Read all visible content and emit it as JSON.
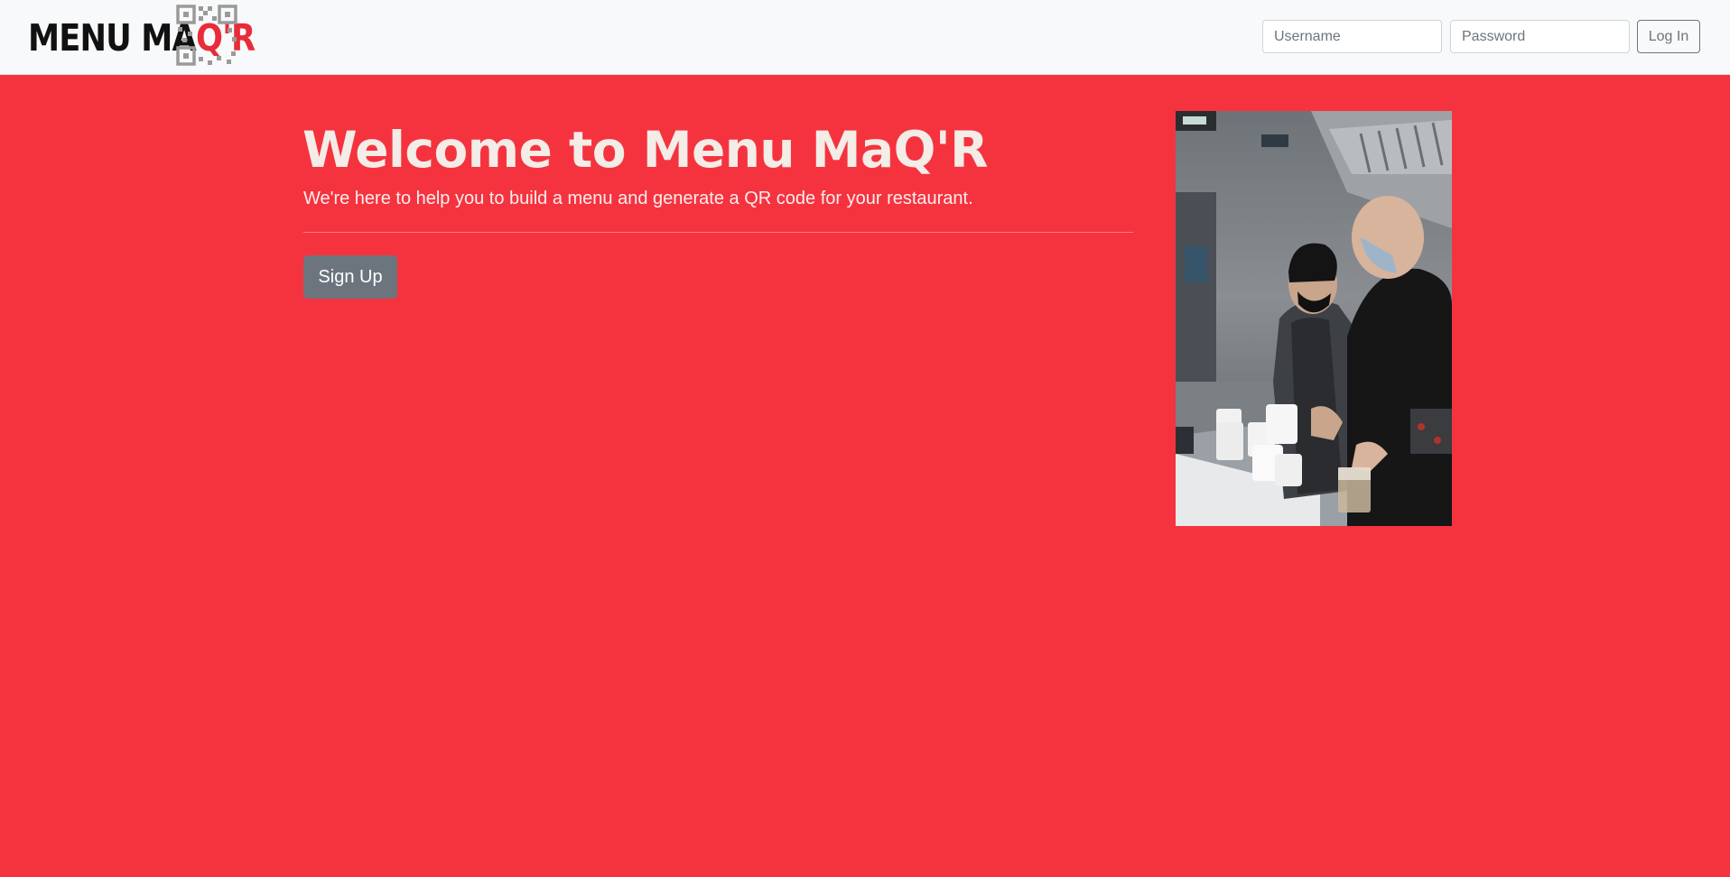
{
  "navbar": {
    "logo": {
      "text_main": "MENU MA",
      "text_accent": "Q'R",
      "accent_color": "#e82c39",
      "qr_color": "#9a9a9a"
    },
    "login": {
      "username_placeholder": "Username",
      "password_placeholder": "Password",
      "button_label": "Log In"
    }
  },
  "hero": {
    "title": "Welcome to Menu MaQ'R",
    "lead": "We're here to help you to build a menu and generate a QR code for your restaurant.",
    "signup_label": "Sign Up",
    "background_color": "#f5333f"
  },
  "image": {
    "subject": "two masked cooks in a restaurant kitchen filling white cups"
  }
}
